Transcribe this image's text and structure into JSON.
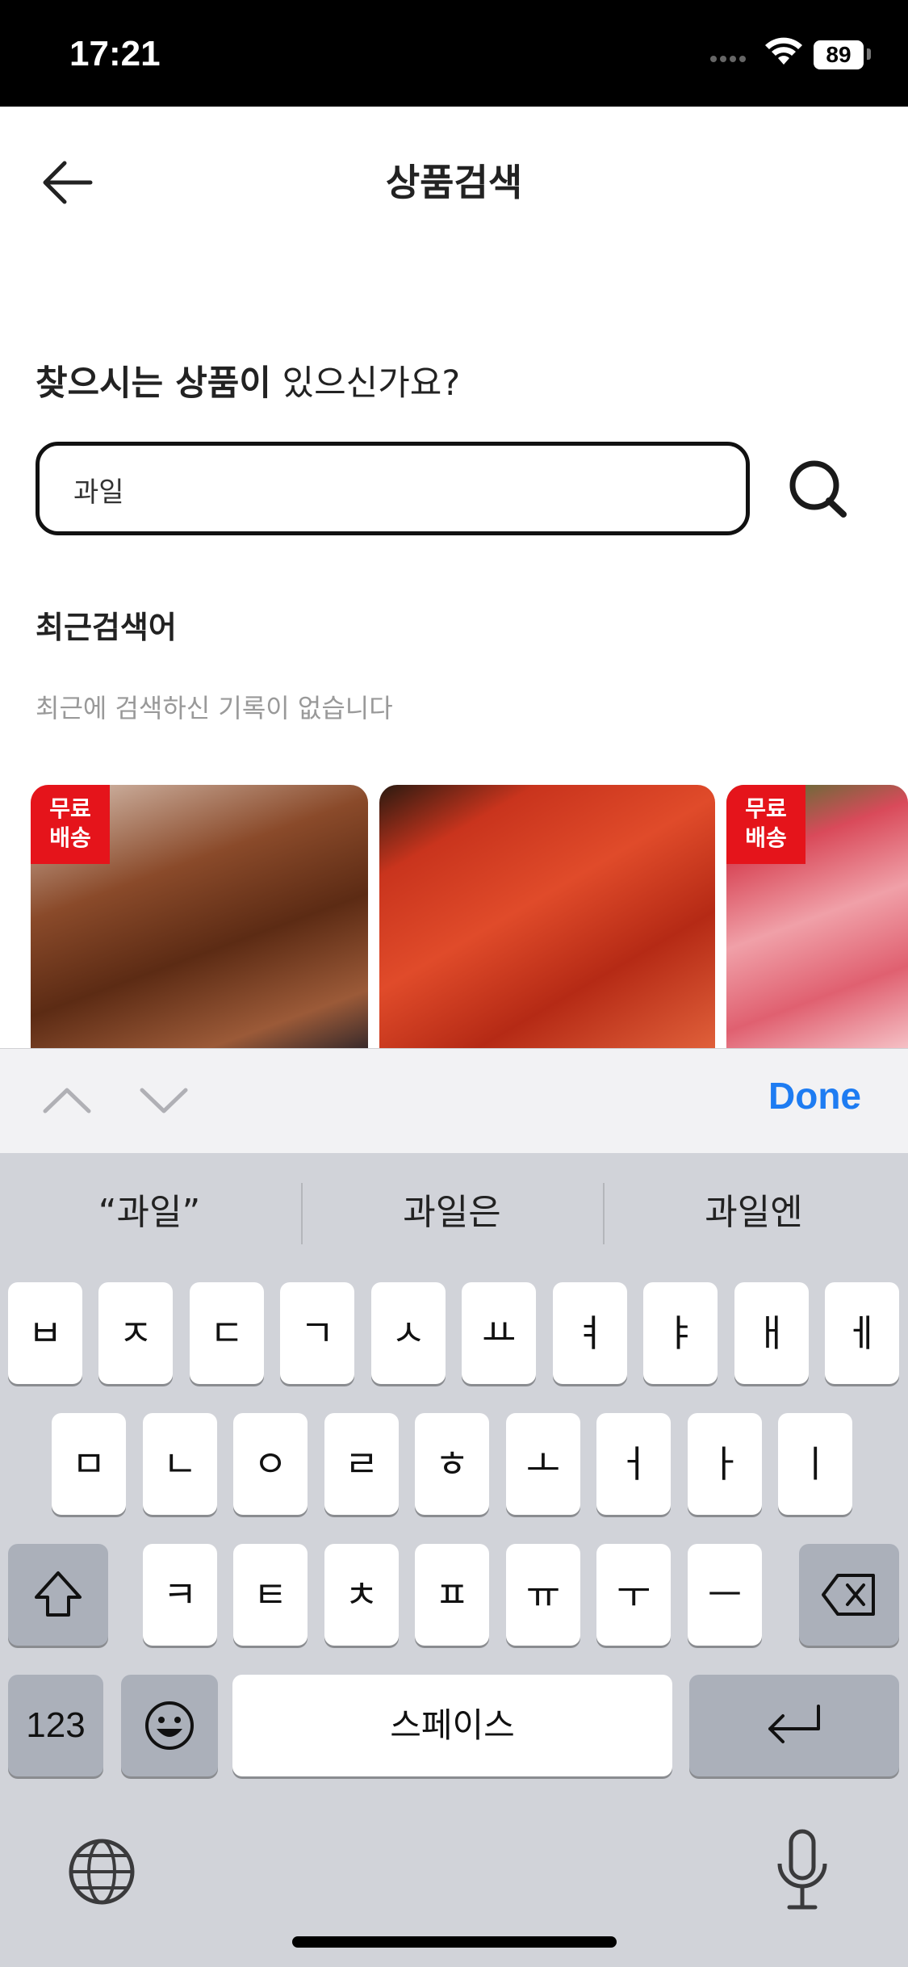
{
  "status_bar": {
    "time": "17:21",
    "battery": "89"
  },
  "header": {
    "title": "상품검색",
    "back_icon": "arrow-left-icon"
  },
  "prompt": {
    "bold_part": "찾으시는 상품이",
    "rest": " 있으신가요?"
  },
  "search": {
    "value": "과일",
    "placeholder": "",
    "icon": "search-icon"
  },
  "recent": {
    "title": "최근검색어",
    "empty_message": "최근에 검색하신 기록이 없습니다"
  },
  "products": [
    {
      "badge_line1": "무료",
      "badge_line2": "배송"
    },
    {
      "badge_line1": "",
      "badge_line2": ""
    },
    {
      "badge_line1": "무료",
      "badge_line2": "배송"
    }
  ],
  "accessory": {
    "done_label": "Done"
  },
  "keyboard": {
    "suggestions": [
      "“과일”",
      "과일은",
      "과일엔"
    ],
    "row1": [
      "ㅂ",
      "ㅈ",
      "ㄷ",
      "ㄱ",
      "ㅅ",
      "ㅛ",
      "ㅕ",
      "ㅑ",
      "ㅐ",
      "ㅔ"
    ],
    "row2": [
      "ㅁ",
      "ㄴ",
      "ㅇ",
      "ㄹ",
      "ㅎ",
      "ㅗ",
      "ㅓ",
      "ㅏ",
      "ㅣ"
    ],
    "row3": [
      "ㅋ",
      "ㅌ",
      "ㅊ",
      "ㅍ",
      "ㅠ",
      "ㅜ",
      "ㅡ"
    ],
    "numbers_label": "123",
    "space_label": "스페이스"
  },
  "colors": {
    "accent": "#1e7cf2",
    "badge": "#e5141b",
    "keyboard_bg": "#d1d3d9"
  }
}
